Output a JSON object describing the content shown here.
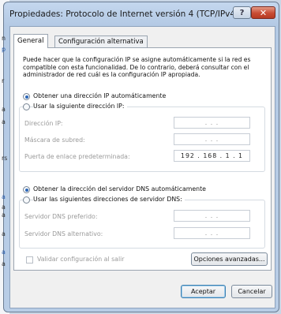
{
  "window": {
    "title": "Propiedades: Protocolo de Internet versión 4 (TCP/IPv4)",
    "help_glyph": "?",
    "close_glyph": "✕"
  },
  "tabs": [
    {
      "label": "General"
    },
    {
      "label": "Configuración alternativa"
    }
  ],
  "description": "Puede hacer que la configuración IP se asigne automáticamente si la red es compatible con esta funcionalidad. De lo contrario, deberá consultar con el administrador de red cuál es la configuración IP apropiada.",
  "ip": {
    "auto_label": "Obtener una dirección IP automáticamente",
    "manual_label": "Usar la siguiente dirección IP:",
    "address_label": "Dirección IP:",
    "mask_label": "Máscara de subred:",
    "gateway_label": "Puerta de enlace predeterminada:",
    "address_value": ".    .    .",
    "mask_value": ".    .    .",
    "gateway_value": "192 . 168 .  1  .  1"
  },
  "dns": {
    "auto_label": "Obtener la dirección del servidor DNS automáticamente",
    "manual_label": "Usar las siguientes direcciones de servidor DNS:",
    "preferred_label": "Servidor DNS preferido:",
    "alternate_label": "Servidor DNS alternativo:",
    "preferred_value": ".    .    .",
    "alternate_value": ".    .    ."
  },
  "validate_label": "Validar configuración al salir",
  "buttons": {
    "advanced": "Opciones avanzadas...",
    "ok": "Aceptar",
    "cancel": "Cancelar"
  },
  "background_chars": [
    "n",
    "p",
    "r",
    "a",
    "a",
    "rs",
    "a",
    "a",
    "a",
    "a",
    "a",
    "a"
  ]
}
